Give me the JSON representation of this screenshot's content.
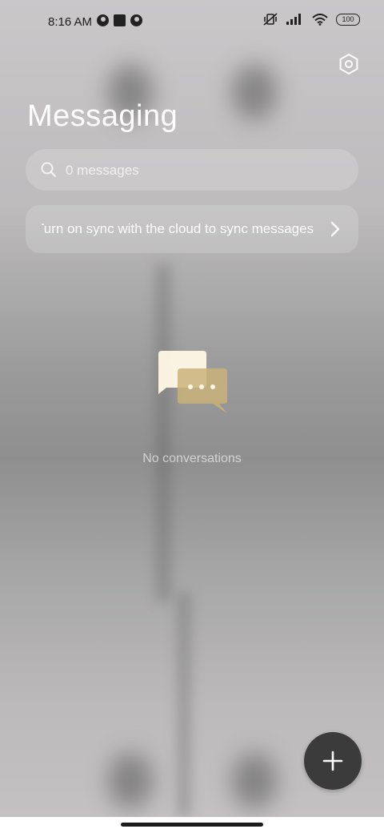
{
  "status_bar": {
    "time": "8:16 AM",
    "battery": "100"
  },
  "header": {
    "title": "Messaging",
    "settings_icon": "settings-hex-icon"
  },
  "search": {
    "placeholder": "0 messages"
  },
  "sync_banner": {
    "text": "Turn on sync with the cloud to sync messages"
  },
  "empty_state": {
    "text": "No conversations",
    "front_bubble_color": "#fff8e6",
    "back_bubble_color": "#c9b27a"
  },
  "fab": {
    "icon": "plus-icon",
    "color": "#3b3b3b"
  }
}
